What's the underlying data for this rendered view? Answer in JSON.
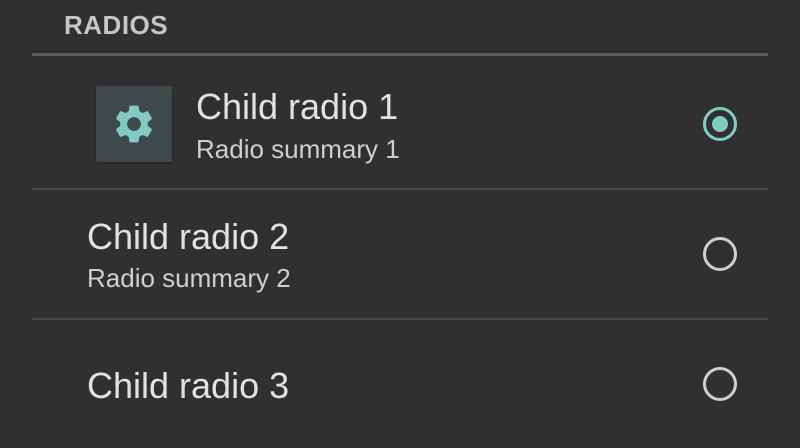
{
  "section": {
    "header": "RADIOS"
  },
  "items": [
    {
      "title": "Child radio 1",
      "summary": "Radio summary 1",
      "icon": "gear-icon",
      "checked": true
    },
    {
      "title": "Child radio 2",
      "summary": "Radio summary 2",
      "checked": false
    },
    {
      "title": "Child radio 3",
      "checked": false
    }
  ],
  "colors": {
    "background": "#303030",
    "accent": "#80cbc4",
    "text_primary": "#e2e2e2",
    "text_secondary": "#cfcfcf",
    "divider": "#5e5e5e"
  }
}
